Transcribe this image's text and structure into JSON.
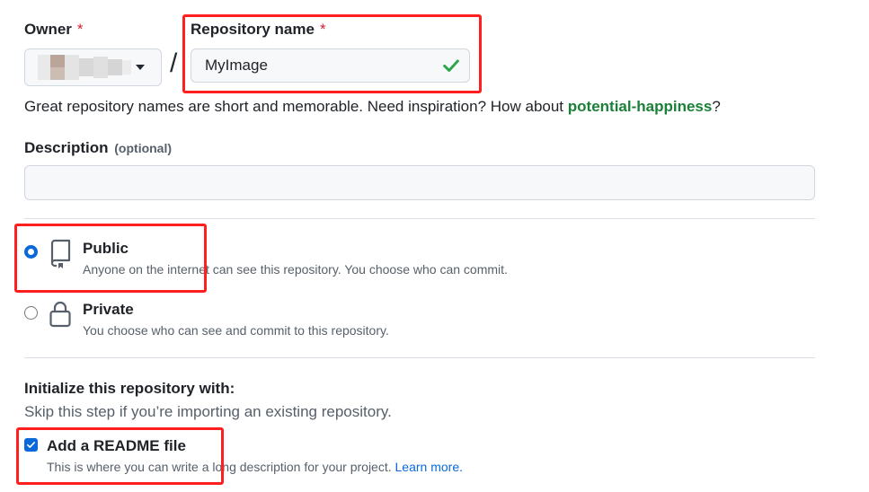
{
  "owner": {
    "label": "Owner",
    "required_marker": "*"
  },
  "repository": {
    "label": "Repository name",
    "required_marker": "*",
    "value": "MyImage",
    "separator": "/",
    "valid_icon": "check-icon"
  },
  "hint": {
    "text": "Great repository names are short and memorable. Need inspiration? How about ",
    "suggestion": "potential-happiness",
    "suffix": "?"
  },
  "description": {
    "label": "Description",
    "optional": "(optional)",
    "value": ""
  },
  "visibility": {
    "options": [
      {
        "title": "Public",
        "description": "Anyone on the internet can see this repository. You choose who can commit.",
        "icon": "repo-icon",
        "selected": true
      },
      {
        "title": "Private",
        "description": "You choose who can see and commit to this repository.",
        "icon": "lock-icon",
        "selected": false
      }
    ]
  },
  "initialize": {
    "heading": "Initialize this repository with:",
    "subheading": "Skip this step if you’re importing an existing repository.",
    "readme": {
      "label": "Add a README file",
      "description": "This is where you can write a long description for your project. ",
      "link": "Learn more.",
      "checked": true
    }
  },
  "colors": {
    "accent": "#0969da",
    "success": "#1a7f37",
    "required": "#cf222e",
    "highlight": "#ff1f1f"
  }
}
